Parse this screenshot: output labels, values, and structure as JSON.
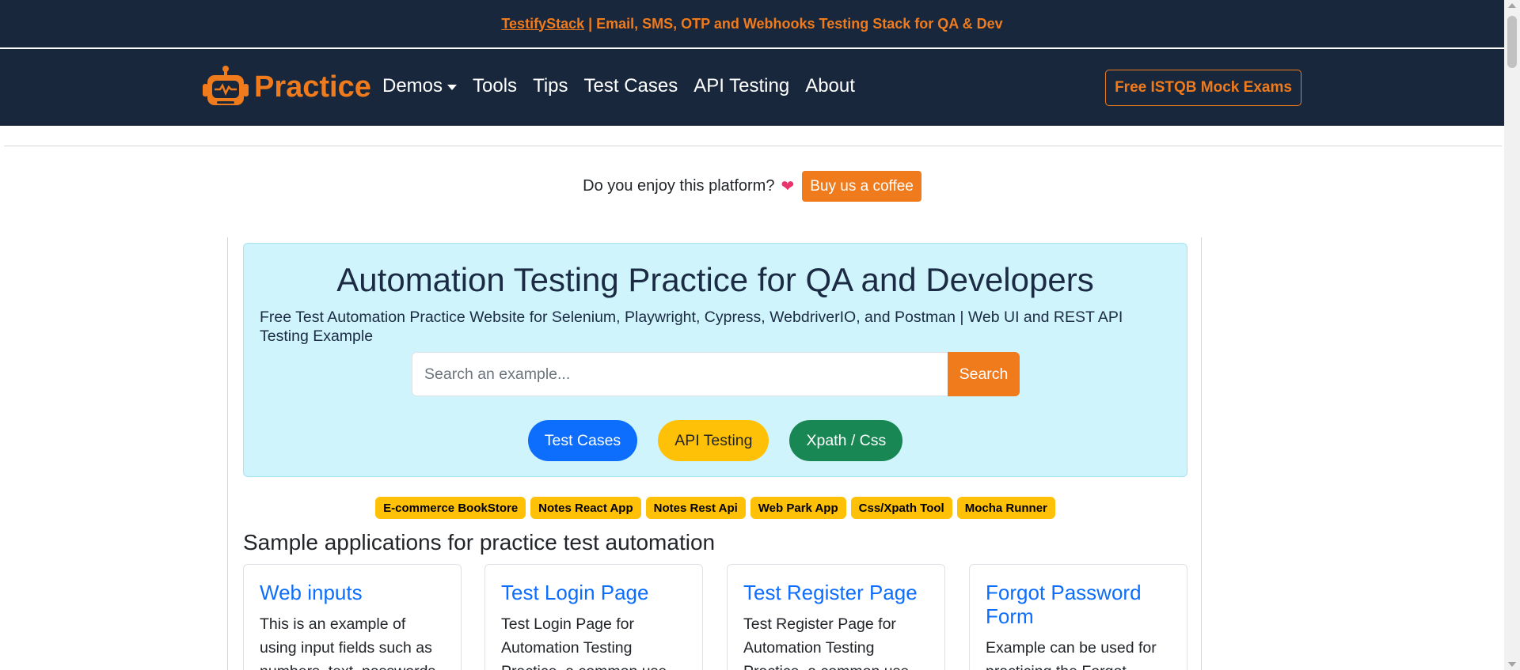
{
  "announcement": {
    "link_text": "TestifyStack",
    "text": " | Email, SMS, OTP and Webhooks Testing Stack for QA & Dev"
  },
  "navbar": {
    "brand": "Practice",
    "links": [
      "Demos",
      "Tools",
      "Tips",
      "Test Cases",
      "API Testing",
      "About"
    ],
    "cta": "Free ISTQB Mock Exams"
  },
  "coffee": {
    "text": "Do you enjoy this platform?",
    "heart": "❤",
    "button": "Buy us a coffee"
  },
  "hero": {
    "title": "Automation Testing Practice for QA and Developers",
    "subtitle": "Free Test Automation Practice Website for Selenium, Playwright, Cypress, WebdriverIO, and Postman | Web UI and REST API Testing Example",
    "search_placeholder": "Search an example...",
    "search_button": "Search",
    "pills": [
      "Test Cases",
      "API Testing",
      "Xpath / Css"
    ]
  },
  "badges": [
    "E-commerce BookStore",
    "Notes React App",
    "Notes Rest Api",
    "Web Park App",
    "Css/Xpath Tool",
    "Mocha Runner"
  ],
  "section_title": "Sample applications for practice test automation",
  "cards": [
    {
      "title": "Web inputs",
      "text": "This is an example of using input fields such as numbers, text, passwords"
    },
    {
      "title": "Test Login Page",
      "text": "Test Login Page for Automation Testing Practice, a common use"
    },
    {
      "title": "Test Register Page",
      "text": "Test Register Page for Automation Testing Practice, a common use"
    },
    {
      "title": "Forgot Password Form",
      "text": "Example can be used for practicing the Forgot"
    }
  ],
  "colors": {
    "navbar_bg": "#18273b",
    "accent_orange": "#f07b1c",
    "hero_bg": "#cff4fc",
    "link_blue": "#0d6efd",
    "badge_yellow": "#ffc107",
    "pill_green": "#198754"
  }
}
